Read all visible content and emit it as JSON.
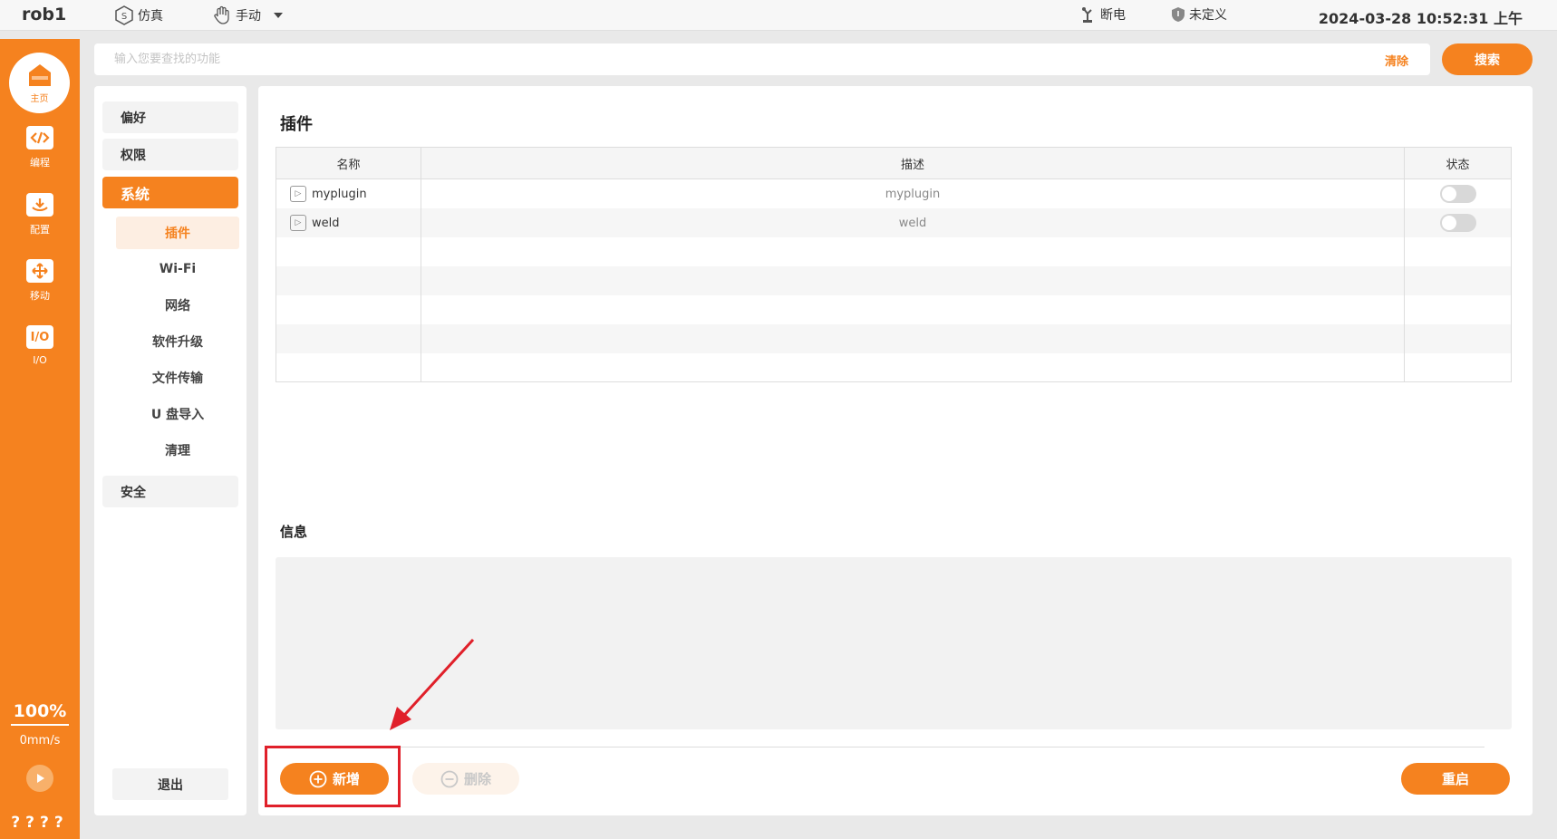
{
  "topbar": {
    "robot_name": "rob1",
    "sim_label": "仿真",
    "mode_label": "手动",
    "power_label": "断电",
    "safety_label": "未定义",
    "datetime": "2024-03-28 10:52:31 上午"
  },
  "rail": {
    "home": "主页",
    "program": "编程",
    "config": "配置",
    "move": "移动",
    "io": "I/O",
    "io_icon_text": "I/O",
    "speed_percent": "100%",
    "speed_mms": "0mm/s",
    "bottom_marks": "????"
  },
  "search": {
    "placeholder": "输入您要查找的功能",
    "clear": "清除",
    "button": "搜索"
  },
  "menu": {
    "preference": "偏好",
    "permission": "权限",
    "system": "系统",
    "sub": [
      "插件",
      "Wi-Fi",
      "网络",
      "软件升级",
      "文件传输",
      "U 盘导入",
      "清理"
    ],
    "safety": "安全",
    "logout": "退出"
  },
  "content": {
    "plugin_title": "插件",
    "columns": {
      "name": "名称",
      "desc": "描述",
      "status": "状态"
    },
    "rows": [
      {
        "name": "myplugin",
        "desc": "myplugin",
        "enabled": false
      },
      {
        "name": "weld",
        "desc": "weld",
        "enabled": false
      }
    ],
    "info_title": "信息",
    "add": "新增",
    "delete": "删除",
    "restart": "重启"
  },
  "colors": {
    "accent": "#f5821f",
    "annotation": "#e0202a"
  }
}
